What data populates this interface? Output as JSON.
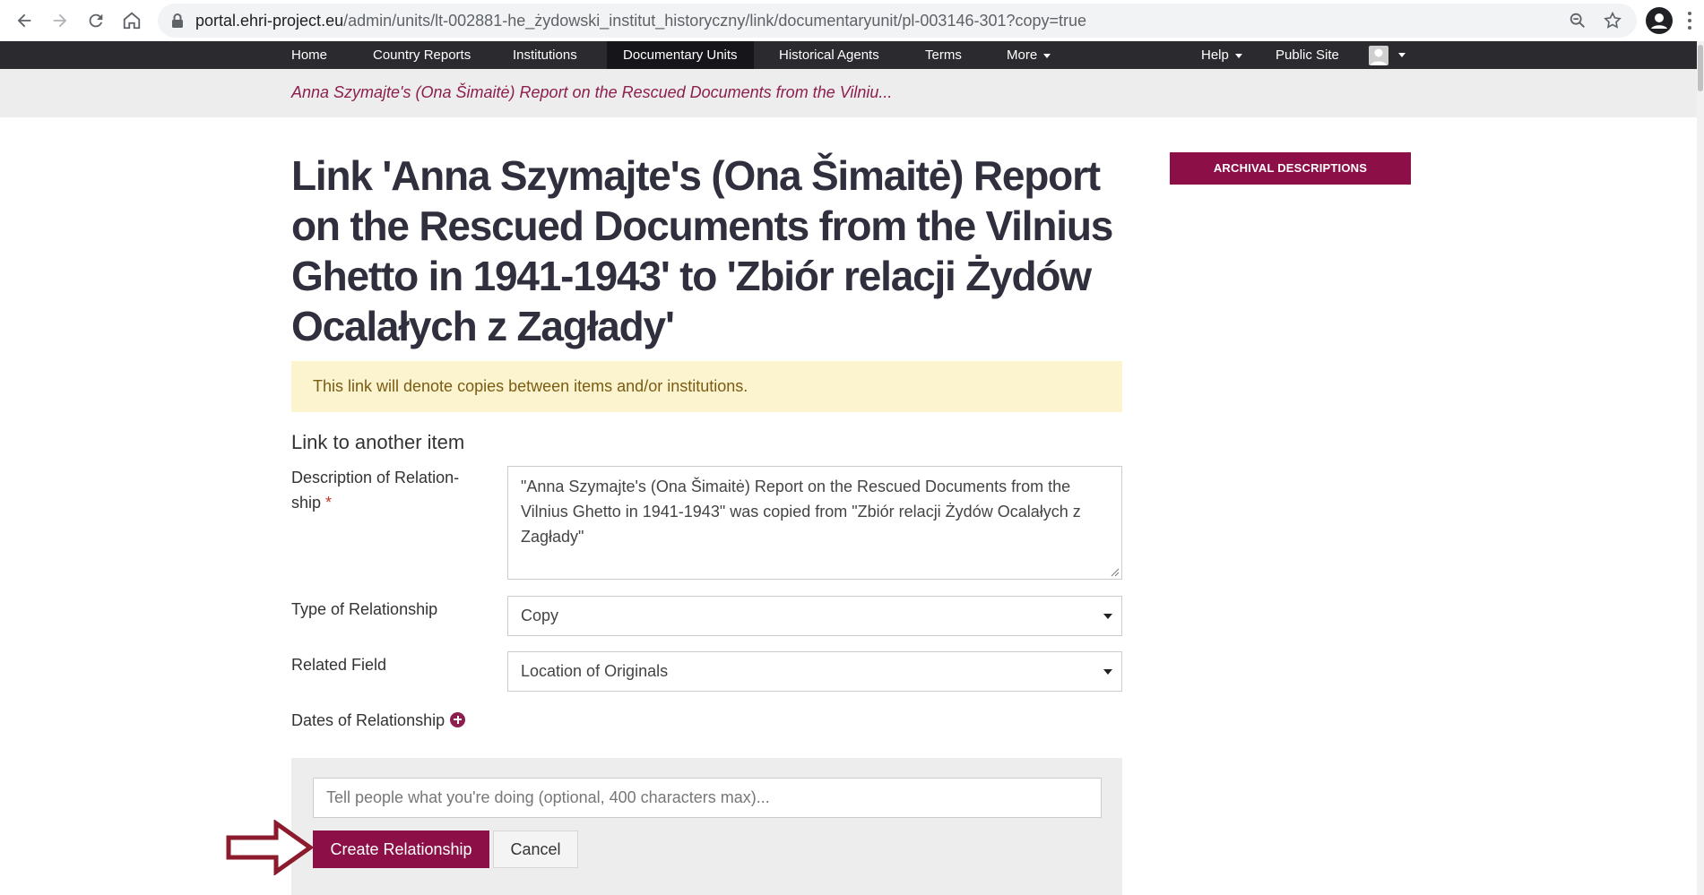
{
  "browser": {
    "url_host": "portal.ehri-project.eu",
    "url_path": "/admin/units/lt-002881-he_żydowski_institut_historyczny/link/documentaryunit/pl-003146-301?copy=true"
  },
  "nav": {
    "items": [
      {
        "label": "Home"
      },
      {
        "label": "Country Reports"
      },
      {
        "label": "Institutions"
      },
      {
        "label": "Documentary Units"
      },
      {
        "label": "Historical Agents"
      },
      {
        "label": "Terms"
      },
      {
        "label": "More"
      }
    ],
    "right": [
      {
        "label": "Help"
      },
      {
        "label": "Public Site"
      }
    ]
  },
  "breadcrumb": {
    "text": "Anna Szymajte's (Ona Šimaitė) Report on the Rescued Documents from the Vilniu..."
  },
  "page": {
    "title": "Link 'Anna Szymajte's (Ona Šimaitė) Report on the Rescued Documents from the Vilnius Ghetto in 1941-1943' to 'Zbiór relacji Żydów Ocalałych z Zagłady'",
    "alert": "This link will denote copies between items and/or institutions.",
    "section_title": "Link to another item"
  },
  "form": {
    "description_label": "Description of Relation-ship",
    "description_label_line1": "Description of Relation-",
    "description_label_line2": "ship",
    "required_mark": "*",
    "description_value": "\"Anna Szymajte's (Ona Šimaitė) Report on the Rescued Documents from the Vilnius Ghetto in 1941-1943\" was copied from \"Zbiór relacji Żydów Ocalałych z Zagłady\"",
    "type_label": "Type of Relationship",
    "type_value": "Copy",
    "related_field_label": "Related Field",
    "related_field_value": "Location of Originals",
    "dates_label": "Dates of Relationship",
    "comment_placeholder": "Tell people what you're doing (optional, 400 characters max)...",
    "submit_label": "Create Relationship",
    "cancel_label": "Cancel"
  },
  "sidebar": {
    "button_label": "ARCHIVAL DESCRIPTIONS"
  },
  "colors": {
    "brand": "#8c1047",
    "nav_bg": "#2a2a2f",
    "alert_bg": "#fcf3cf",
    "annotation_arrow": "#8c1b2e"
  },
  "icons": [
    "back-icon",
    "forward-icon",
    "reload-icon",
    "home-icon",
    "lock-icon",
    "zoom-icon",
    "star-icon",
    "profile-icon",
    "menu-icon",
    "plus-circle-icon",
    "arrow-annotation"
  ]
}
